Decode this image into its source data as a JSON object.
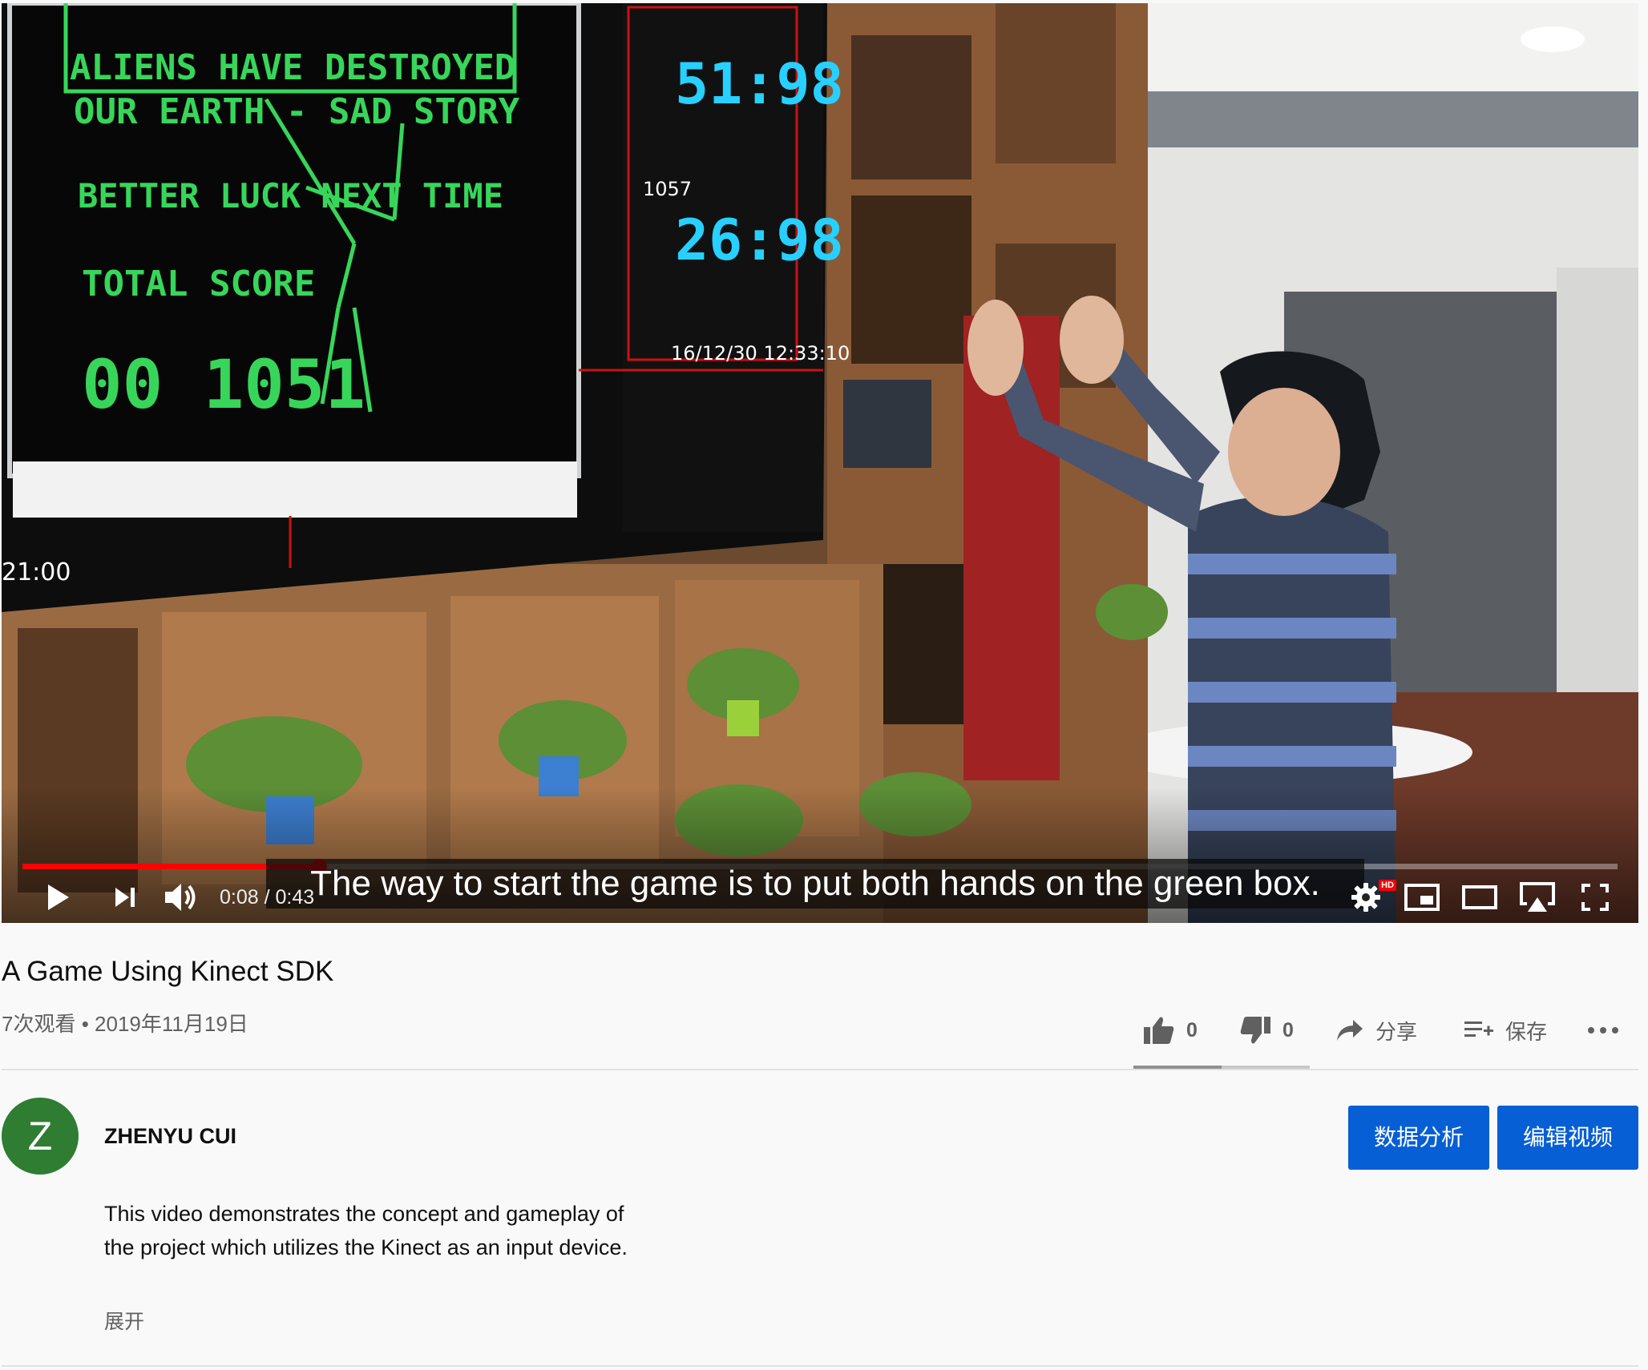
{
  "player": {
    "caption": "The way to start the game is to put both hands on the green box.",
    "current_time": "0:08",
    "duration": "0:43",
    "time_separator": " / ",
    "progress_fraction": 0.186,
    "hd_badge": "HD",
    "colors": {
      "progress": "#ff0000",
      "caption_bg": "#080808"
    }
  },
  "video": {
    "title": "A Game Using Kinect SDK",
    "views": "7次观看",
    "meta_separator": " • ",
    "date": "2019年11月19日"
  },
  "actions": {
    "like_count": "0",
    "dislike_count": "0",
    "share_label": "分享",
    "save_label": "保存",
    "like_fraction": 0.5
  },
  "channel": {
    "avatar_letter": "Z",
    "avatar_color": "#2e7d32",
    "name": "ZHENYU CUI",
    "analytics_label": "数据分析",
    "edit_label": "编辑视频",
    "button_color": "#065fd4"
  },
  "description": {
    "line1": "This video demonstrates the concept and gameplay of",
    "line2": "the project which utilizes the Kinect as an input device.",
    "show_more": "展开"
  }
}
